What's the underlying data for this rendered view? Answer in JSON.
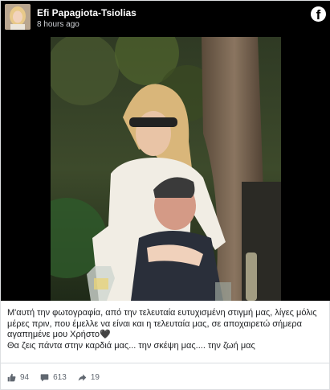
{
  "post": {
    "author": "Efi Papagiota-Tsiolias",
    "time": "8 hours ago",
    "caption_line1": "Μ'αυτή την φωτογραφία, από την τελευταία ευτυχισμένη στιγμή μας, λίγες μόλις μέρες πριν, που έμελλε να είναι και η τελευταία μας, σε αποχαιρετώ σήμερα αγαπημένε μου Χρήστο🖤",
    "caption_line2": "Θα ζεις πάντα στην καρδιά μας... την σκέψη μας.... την ζωή μας"
  },
  "stats": {
    "likes": "94",
    "comments": "613",
    "shares": "19"
  },
  "icons": {
    "platform_logo": "facebook-icon",
    "like": "thumbs-up-icon",
    "comment": "comment-icon",
    "share": "share-arrow-icon"
  },
  "colors": {
    "header_bg": "#000000",
    "text": "#1c1e21",
    "muted": "#606770"
  }
}
